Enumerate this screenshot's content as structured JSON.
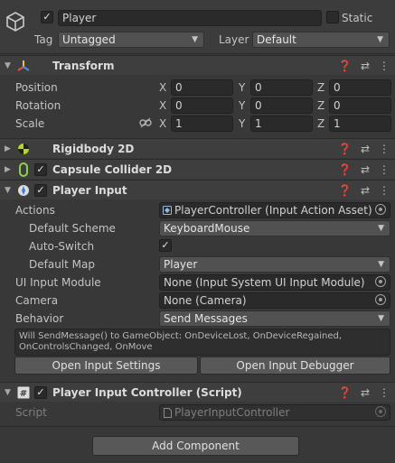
{
  "object": {
    "active": true,
    "name": "Player",
    "static_label": "Static",
    "static_checked": false,
    "tag_label": "Tag",
    "tag_value": "Untagged",
    "layer_label": "Layer",
    "layer_value": "Default"
  },
  "transform": {
    "title": "Transform",
    "rows": [
      {
        "label": "Position",
        "x": "0",
        "y": "0",
        "z": "0"
      },
      {
        "label": "Rotation",
        "x": "0",
        "y": "0",
        "z": "0"
      },
      {
        "label": "Scale",
        "x": "1",
        "y": "1",
        "z": "1"
      }
    ],
    "axis_x": "X",
    "axis_y": "Y",
    "axis_z": "Z"
  },
  "rigidbody": {
    "title": "Rigidbody 2D"
  },
  "capsule": {
    "title": "Capsule Collider 2D",
    "enabled": true
  },
  "player_input": {
    "title": "Player Input",
    "enabled": true,
    "actions_label": "Actions",
    "actions_value": "PlayerController (Input Action Asset)",
    "default_scheme_label": "Default Scheme",
    "default_scheme_value": "KeyboardMouse",
    "auto_switch_label": "Auto-Switch",
    "auto_switch_checked": true,
    "default_map_label": "Default Map",
    "default_map_value": "Player",
    "ui_input_module_label": "UI Input Module",
    "ui_input_module_value": "None (Input System UI Input Module)",
    "camera_label": "Camera",
    "camera_value": "None (Camera)",
    "behavior_label": "Behavior",
    "behavior_value": "Send Messages",
    "info_text": "Will SendMessage() to GameObject: OnDeviceLost, OnDeviceRegained, OnControlsChanged, OnMove",
    "open_settings_label": "Open Input Settings",
    "open_debugger_label": "Open Input Debugger"
  },
  "script_component": {
    "title": "Player Input Controller (Script)",
    "enabled": true,
    "script_label": "Script",
    "script_value": "PlayerInputController"
  },
  "add_component_label": "Add Component",
  "checkmark": "✓",
  "colors": {
    "background": "#383838",
    "header": "#3e3e3e",
    "field": "#2a2a2a",
    "button": "#585858",
    "rigidbody_icon": "#b5d62b",
    "collider_icon": "#8fd14f"
  }
}
